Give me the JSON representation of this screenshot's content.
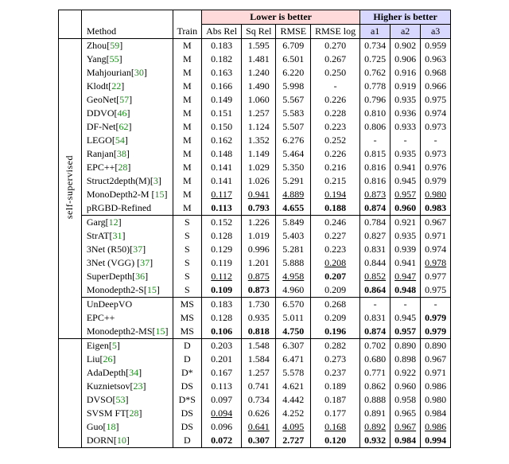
{
  "headers": {
    "method": "Method",
    "train": "Train",
    "lower_group": "Lower is better",
    "higher_group": "Higher is better",
    "cols_lower": [
      "Abs Rel",
      "Sq Rel",
      "RMSE",
      "RMSE log"
    ],
    "cols_higher": [
      "a1",
      "a2",
      "a3"
    ]
  },
  "rotated_label": "self-supervised",
  "chart_data": {
    "type": "table",
    "sections": [
      {
        "rows": [
          {
            "method": "Zhou",
            "cite": "59",
            "train": "M",
            "vals": [
              "0.183",
              "1.595",
              "6.709",
              "0.270",
              "0.734",
              "0.902",
              "0.959"
            ]
          },
          {
            "method": "Yang",
            "cite": "55",
            "train": "M",
            "vals": [
              "0.182",
              "1.481",
              "6.501",
              "0.267",
              "0.725",
              "0.906",
              "0.963"
            ]
          },
          {
            "method": "Mahjourian",
            "cite": "30",
            "train": "M",
            "vals": [
              "0.163",
              "1.240",
              "6.220",
              "0.250",
              "0.762",
              "0.916",
              "0.968"
            ]
          },
          {
            "method": "Klodt",
            "cite": "22",
            "train": "M",
            "vals": [
              "0.166",
              "1.490",
              "5.998",
              "-",
              "0.778",
              "0.919",
              "0.966"
            ]
          },
          {
            "method": "GeoNet",
            "cite": "57",
            "train": "M",
            "vals": [
              "0.149",
              "1.060",
              "5.567",
              "0.226",
              "0.796",
              "0.935",
              "0.975"
            ]
          },
          {
            "method": "DDVO",
            "cite": "46",
            "train": "M",
            "vals": [
              "0.151",
              "1.257",
              "5.583",
              "0.228",
              "0.810",
              "0.936",
              "0.974"
            ]
          },
          {
            "method": "DF-Net",
            "cite": "62",
            "train": "M",
            "vals": [
              "0.150",
              "1.124",
              "5.507",
              "0.223",
              "0.806",
              "0.933",
              "0.973"
            ]
          },
          {
            "method": "LEGO",
            "cite": "54",
            "train": "M",
            "vals": [
              "0.162",
              "1.352",
              "6.276",
              "0.252",
              "-",
              "-",
              "-"
            ]
          },
          {
            "method": "Ranjan",
            "cite": "38",
            "train": "M",
            "vals": [
              "0.148",
              "1.149",
              "5.464",
              "0.226",
              "0.815",
              "0.935",
              "0.973"
            ]
          },
          {
            "method": "EPC++",
            "cite": "28",
            "train": "M",
            "vals": [
              "0.141",
              "1.029",
              "5.350",
              "0.216",
              "0.816",
              "0.941",
              "0.976"
            ]
          },
          {
            "method": "Struct2depth(M)",
            "cite": "3",
            "train": "M",
            "vals": [
              "0.141",
              "1.026",
              "5.291",
              "0.215",
              "0.816",
              "0.945",
              "0.979"
            ]
          },
          {
            "method": "MonoDepth2-M ",
            "cite": "15",
            "train": "M",
            "vals": [
              "0.117_u",
              "0.941_u",
              "4.889_u",
              "0.194_u",
              "0.873_u",
              "0.957_u",
              "0.980_u"
            ]
          },
          {
            "method": "pRGBD-Refined",
            "cite": "",
            "train": "M",
            "vals": [
              "0.113_b",
              "0.793_b",
              "4.655_b",
              "0.188_b",
              "0.874_b",
              "0.960_b",
              "0.983_b"
            ]
          }
        ]
      },
      {
        "rows": [
          {
            "method": "Garg",
            "cite": "12",
            "train": "S",
            "vals": [
              "0.152",
              "1.226",
              "5.849",
              "0.246",
              "0.784",
              "0.921",
              "0.967"
            ]
          },
          {
            "method": "StrAT",
            "cite": "31",
            "train": "S",
            "vals": [
              "0.128",
              "1.019",
              "5.403",
              "0.227",
              "0.827",
              "0.935",
              "0.971"
            ]
          },
          {
            "method": "3Net (R50)",
            "cite": "37",
            "train": "S",
            "vals": [
              "0.129",
              "0.996",
              "5.281",
              "0.223",
              "0.831",
              "0.939",
              "0.974"
            ]
          },
          {
            "method": "3Net (VGG) ",
            "cite": "37",
            "train": "S",
            "vals": [
              "0.119",
              "1.201",
              "5.888",
              "0.208_u",
              "0.844",
              "0.941",
              "0.978_u"
            ]
          },
          {
            "method": "SuperDepth",
            "cite": "36",
            "train": "S",
            "vals": [
              "0.112_u",
              "0.875_u",
              "4.958_u",
              "0.207_b",
              "0.852_u",
              "0.947_u",
              "0.977"
            ]
          },
          {
            "method": "Monodepth2-S",
            "cite": "15",
            "train": "S",
            "vals": [
              "0.109_b",
              "0.873_b",
              "4.960",
              "0.209",
              "0.864_b",
              "0.948_b",
              "0.975"
            ]
          }
        ]
      },
      {
        "rows": [
          {
            "method": "UnDeepVO",
            "cite": "",
            "train": "MS",
            "vals": [
              "0.183",
              "1.730",
              "6.570",
              "0.268",
              "-",
              "-",
              "-"
            ]
          },
          {
            "method": "EPC++",
            "cite": "",
            "train": "MS",
            "vals": [
              "0.128",
              "0.935",
              "5.011",
              "0.209",
              "0.831",
              "0.945",
              "0.979_b"
            ]
          },
          {
            "method": "Monodepth2-MS",
            "cite": "15",
            "train": "MS",
            "vals": [
              "0.106_b",
              "0.818_b",
              "4.750_b",
              "0.196_b",
              "0.874_b",
              "0.957_b",
              "0.979_b"
            ]
          }
        ]
      },
      {
        "rows": [
          {
            "method": "Eigen",
            "cite": "5",
            "train": "D",
            "vals": [
              "0.203",
              "1.548",
              "6.307",
              "0.282",
              "0.702",
              "0.890",
              "0.890"
            ]
          },
          {
            "method": "Liu",
            "cite": "26",
            "train": "D",
            "vals": [
              "0.201",
              "1.584",
              "6.471",
              "0.273",
              "0.680",
              "0.898",
              "0.967"
            ]
          },
          {
            "method": "AdaDepth",
            "cite": "34",
            "train": "D*",
            "vals": [
              "0.167",
              "1.257",
              "5.578",
              "0.237",
              "0.771",
              "0.922",
              "0.971"
            ]
          },
          {
            "method": "Kuznietsov",
            "cite": "23",
            "train": "DS",
            "vals": [
              "0.113",
              "0.741",
              "4.621",
              "0.189",
              "0.862",
              "0.960",
              "0.986"
            ]
          },
          {
            "method": "DVSO",
            "cite": "53",
            "train": "D*S",
            "vals": [
              "0.097",
              "0.734",
              "4.442",
              "0.187",
              "0.888",
              "0.958",
              "0.980"
            ]
          },
          {
            "method": "SVSM FT",
            "cite": "28",
            "train": "DS",
            "vals": [
              "0.094_u",
              "0.626",
              "4.252",
              "0.177",
              "0.891",
              "0.965",
              "0.984"
            ]
          },
          {
            "method": "Guo",
            "cite": "18",
            "train": "DS",
            "vals": [
              "0.096",
              "0.641_u",
              "4.095_u",
              "0.168_u",
              "0.892_u",
              "0.967_u",
              "0.986_u"
            ]
          },
          {
            "method": "DORN",
            "cite": "10",
            "train": "D",
            "vals": [
              "0.072_b",
              "0.307_b",
              "2.727_b",
              "0.120_b",
              "0.932_b",
              "0.984_b",
              "0.994_b"
            ]
          }
        ]
      }
    ]
  }
}
